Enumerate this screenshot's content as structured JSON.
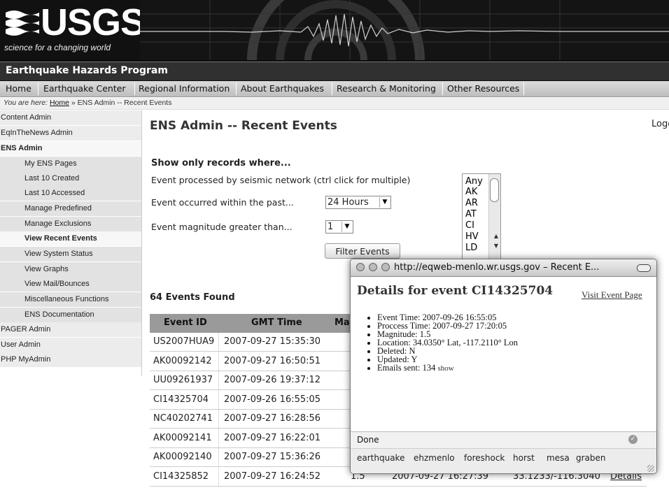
{
  "header": {
    "logo_text": "USGS",
    "tagline": "science for a changing world",
    "program": "Earthquake Hazards Program"
  },
  "topnav": [
    "Home",
    "Earthquake Center",
    "Regional Information",
    "About Earthquakes",
    "Research & Monitoring",
    "Other Resources"
  ],
  "breadcrumb": {
    "prefix": "You are here:",
    "home": "Home",
    "rest": "» ENS Admin -- Recent Events"
  },
  "sidebar": [
    {
      "label": "Content Admin",
      "level": 0
    },
    {
      "label": "EqInTheNews Admin",
      "level": 0
    },
    {
      "label": "ENS Admin",
      "level": 0,
      "bold": true
    },
    {
      "label": "My ENS Pages",
      "level": 1
    },
    {
      "label": "Last 10 Created",
      "level": 1
    },
    {
      "label": "Last 10 Accessed",
      "level": 1
    },
    {
      "label": "Manage Predefined",
      "level": 1
    },
    {
      "label": "Manage Exclusions",
      "level": 1
    },
    {
      "label": "View Recent Events",
      "level": 1,
      "bold": true
    },
    {
      "label": "View System Status",
      "level": 1
    },
    {
      "label": "View Graphs",
      "level": 1
    },
    {
      "label": "View Mail/Bounces",
      "level": 1
    },
    {
      "label": "Miscellaneous Functions",
      "level": 1
    },
    {
      "label": "ENS Documentation",
      "level": 1
    },
    {
      "label": "PAGER Admin",
      "level": 0
    },
    {
      "label": "User Admin",
      "level": 0
    },
    {
      "label": "PHP MyAdmin",
      "level": 0
    }
  ],
  "main": {
    "title": "ENS Admin -- Recent Events",
    "logout": "Logg",
    "filter_heading": "Show only records where...",
    "network_label": "Event processed by seismic network (ctrl click for multiple)",
    "time_label": "Event occurred within the past...",
    "time_value": "24 Hours",
    "mag_label": "Event magnitude greater than...",
    "mag_value": "1",
    "networks": [
      "Any",
      "AK",
      "AR",
      "AT",
      "CI",
      "HV",
      "LD"
    ],
    "filter_button": "Filter Events",
    "found": "64 Events Found"
  },
  "table": {
    "headers": [
      "Event ID",
      "GMT Time",
      "Ma"
    ],
    "rows": [
      {
        "id": "US2007HUA9",
        "time": "2007-09-27 15:35:30"
      },
      {
        "id": "AK00092142",
        "time": "2007-09-27 16:50:51"
      },
      {
        "id": "UU09261937",
        "time": "2007-09-26 19:37:12"
      },
      {
        "id": "CI14325704",
        "time": "2007-09-26 16:55:05"
      },
      {
        "id": "NC40202741",
        "time": "2007-09-27 16:28:56"
      },
      {
        "id": "AK00092141",
        "time": "2007-09-27 16:22:01"
      },
      {
        "id": "AK00092140",
        "time": "2007-09-27 15:36:26"
      },
      {
        "id": "CI14325852",
        "time": "2007-09-27 16:24:52",
        "mag": "1.5",
        "proc": "2007-09-27 16:27:39",
        "loc": "33.1233/-116.3040",
        "details": "Details"
      }
    ]
  },
  "popup": {
    "title": "http://eqweb-menlo.wr.usgs.gov – Recent E...",
    "heading": "Details for event CI14325704",
    "visit": "Visit Event Page",
    "items": [
      "Event Time: 2007-09-26 16:55:05",
      "Proccess Time: 2007-09-27 17:20:05",
      "Magnitude: 1.5",
      "Location: 34.0350° Lat, -117.2110° Lon",
      "Deleted: N",
      "Updated: Y",
      "Emails sent: 134"
    ],
    "show": "show",
    "status": "Done",
    "tags": [
      "earthquake",
      "ehzmenlo",
      "foreshock",
      "horst",
      "mesa",
      "graben"
    ]
  }
}
